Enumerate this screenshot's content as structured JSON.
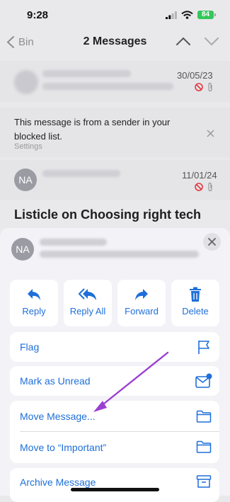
{
  "status_bar": {
    "time": "9:28",
    "battery": "84"
  },
  "nav": {
    "back_label": "Bin",
    "title": "2 Messages"
  },
  "messages": {
    "first_date": "30/05/23",
    "blocked_banner": {
      "text": "This message is from a sender in your blocked list.",
      "settings_label": "Settings"
    },
    "second_avatar": "NA",
    "second_date": "11/01/24",
    "subject": "Listicle on Choosing right tech"
  },
  "sheet": {
    "avatar": "NA",
    "actions": [
      {
        "label": "Reply",
        "icon": "reply-icon"
      },
      {
        "label": "Reply All",
        "icon": "reply-all-icon"
      },
      {
        "label": "Forward",
        "icon": "forward-icon"
      },
      {
        "label": "Delete",
        "icon": "trash-icon"
      }
    ],
    "rows": {
      "flag": "Flag",
      "mark_unread": "Mark as Unread",
      "move_message": "Move Message...",
      "move_important": "Move to “Important”",
      "archive": "Archive Message"
    }
  },
  "colors": {
    "accent": "#1e6fd9",
    "annotation_arrow": "#9b3fd1",
    "battery": "#34c759"
  }
}
